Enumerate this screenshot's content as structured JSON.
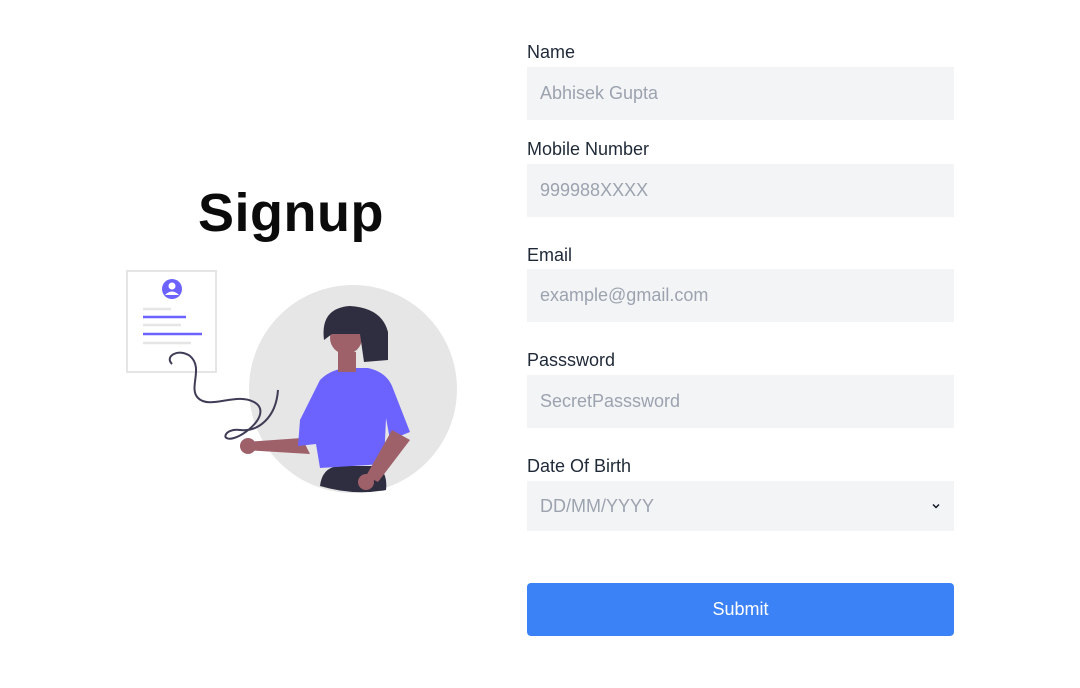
{
  "signup": {
    "title": "Signup"
  },
  "form": {
    "name": {
      "label": "Name",
      "placeholder": "Abhisek Gupta"
    },
    "mobile": {
      "label": "Mobile Number",
      "placeholder": "999988XXXX"
    },
    "email": {
      "label": "Email",
      "placeholder": "example@gmail.com"
    },
    "password": {
      "label": "Passsword",
      "placeholder": "SecretPasssword"
    },
    "dob": {
      "label": "Date Of Birth",
      "value": "DD/MM/YYYY"
    },
    "submit_label": "Submit"
  },
  "colors": {
    "accent": "#3b82f6",
    "illustration_purple": "#6c63ff",
    "input_bg": "#f3f4f6"
  },
  "icons": {
    "illustration": "person-signing-document-illustration",
    "dropdown": "chevron-down-icon"
  }
}
